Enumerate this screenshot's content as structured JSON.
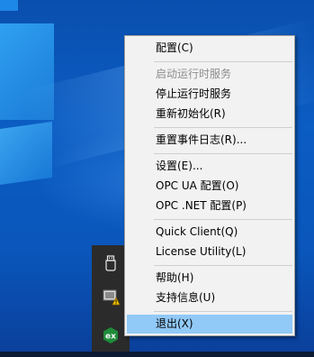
{
  "context_menu": {
    "items": [
      {
        "label": "配置(C)",
        "state": "normal"
      },
      {
        "label": "启动运行时服务",
        "state": "disabled"
      },
      {
        "label": "停止运行时服务",
        "state": "normal"
      },
      {
        "label": "重新初始化(R)",
        "state": "normal"
      },
      {
        "label": "重置事件日志(R)...",
        "state": "normal"
      },
      {
        "label": "设置(E)...",
        "state": "normal"
      },
      {
        "label": "OPC UA 配置(O)",
        "state": "normal"
      },
      {
        "label": "OPC .NET 配置(P)",
        "state": "normal"
      },
      {
        "label": "Quick Client(Q)",
        "state": "normal"
      },
      {
        "label": "License Utility(L)",
        "state": "normal"
      },
      {
        "label": "帮助(H)",
        "state": "normal"
      },
      {
        "label": "支持信息(U)",
        "state": "normal"
      },
      {
        "label": "退出(X)",
        "state": "highlighted"
      }
    ]
  },
  "tray": {
    "icons": [
      {
        "name": "usb-device-icon"
      },
      {
        "name": "vmware-warning-icon"
      },
      {
        "name": "kepserver-ex-icon",
        "text": "ex"
      }
    ]
  },
  "colors": {
    "menu_background": "#f2f2f2",
    "highlight": "#91c9f7",
    "disabled_text": "#8d8d8d",
    "desktop": "#0b5cc3",
    "tray_background": "#2b2b2b",
    "ex_icon": "#1f8b3a"
  }
}
